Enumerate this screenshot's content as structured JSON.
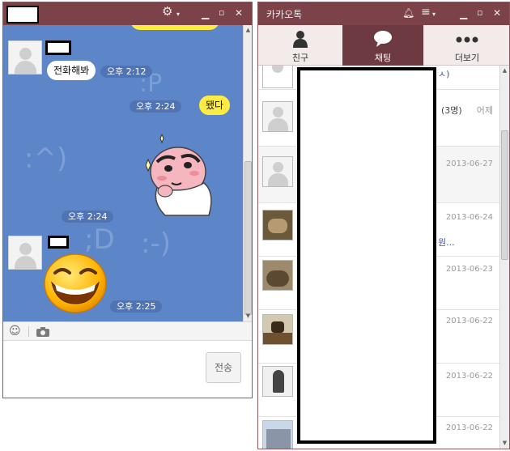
{
  "chat_window": {
    "toolbar_icons": [
      "gear-icon",
      "chevron-down-icon",
      "minimize-icon",
      "maximize-icon",
      "close-icon"
    ],
    "messages": [
      {
        "side": "left",
        "text": "전화해봐",
        "time": "오후 2:12"
      },
      {
        "side": "right",
        "text": "됐다",
        "time": "오후 2:24"
      },
      {
        "side": "left",
        "sticker": "character-sticker",
        "time": "오후 2:24"
      },
      {
        "side": "left",
        "sticker": "grinning-emoticon",
        "time": "오후 2:25"
      }
    ],
    "input_toolbar_icons": [
      "emoticon-icon",
      "camera-icon"
    ],
    "send_label": "전송"
  },
  "list_window": {
    "title": "카카오톡",
    "tabs": [
      {
        "label": "친구",
        "icon": "person-icon",
        "active": false
      },
      {
        "label": "채팅",
        "icon": "speech-bubble-icon",
        "active": true
      },
      {
        "label": "더보기",
        "icon": "more-dots-icon",
        "active": false
      }
    ],
    "rows": [
      {
        "tail": "ㅅ)",
        "date": ""
      },
      {
        "count": "(3명)",
        "date": "어제"
      },
      {
        "date": "2013-06-27"
      },
      {
        "date": "2013-06-24",
        "tail": "원..."
      },
      {
        "date": "2013-06-23"
      },
      {
        "date": "2013-06-22"
      },
      {
        "date": "2013-06-22"
      },
      {
        "date": "2013-06-22"
      }
    ]
  },
  "colors": {
    "titlebar": "#7b4249",
    "chat_bg": "#5d86c9",
    "yellow_bubble": "#ffec42",
    "active_tab": "#6c3a40"
  }
}
